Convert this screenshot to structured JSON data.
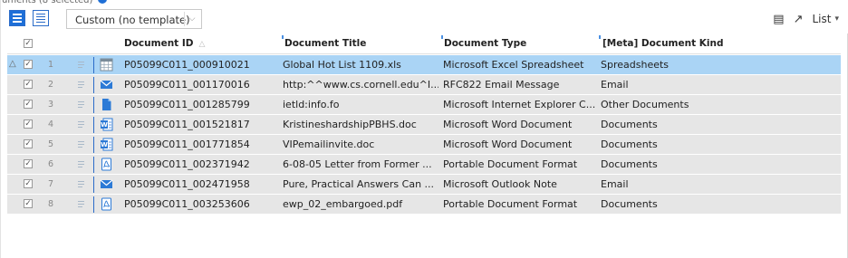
{
  "toolbar": {
    "template_select": {
      "value": "Custom (no template)"
    },
    "list_label": "List"
  },
  "table": {
    "columns": [
      "Document ID",
      "Document Title",
      "Document Type",
      "[Meta] Document Kind"
    ],
    "rows": [
      {
        "num": "1",
        "doc_id": "P05099C011_000910021",
        "title": "Global Hot List 1109.xls",
        "type": "Microsoft Excel Spreadsheet",
        "kind": "Spreadsheets",
        "icon": "excel-icon",
        "selected": true,
        "warning": true
      },
      {
        "num": "2",
        "doc_id": "P05099C011_001170016",
        "title": "http:^^www.cs.cornell.edu^I...",
        "type": "RFC822 Email Message",
        "kind": "Email",
        "icon": "email-icon"
      },
      {
        "num": "3",
        "doc_id": "P05099C011_001285799",
        "title": "ietld:info.fo",
        "type": "Microsoft Internet Explorer C...",
        "kind": "Other Documents",
        "icon": "file-icon"
      },
      {
        "num": "4",
        "doc_id": "P05099C011_001521817",
        "title": "KristineshardshipPBHS.doc",
        "type": "Microsoft Word Document",
        "kind": "Documents",
        "icon": "word-icon"
      },
      {
        "num": "5",
        "doc_id": "P05099C011_001771854",
        "title": "VIPemailinvite.doc",
        "type": "Microsoft Word Document",
        "kind": "Documents",
        "icon": "word-icon"
      },
      {
        "num": "6",
        "doc_id": "P05099C011_002371942",
        "title": "6-08-05 Letter from Former ...",
        "type": "Portable Document Format",
        "kind": "Documents",
        "icon": "pdf-icon"
      },
      {
        "num": "7",
        "doc_id": "P05099C011_002471958",
        "title": "Pure, Practical Answers Can ...",
        "type": "Microsoft Outlook Note",
        "kind": "Email",
        "icon": "email-icon"
      },
      {
        "num": "8",
        "doc_id": "P05099C011_003253606",
        "title": "ewp_02_embargoed.pdf",
        "type": "Portable Document Format",
        "kind": "Documents",
        "icon": "pdf-icon"
      }
    ]
  },
  "colors": {
    "selected_row": "#aad4f5",
    "row": "#e6e6e6",
    "accent": "#1d6fd8"
  }
}
